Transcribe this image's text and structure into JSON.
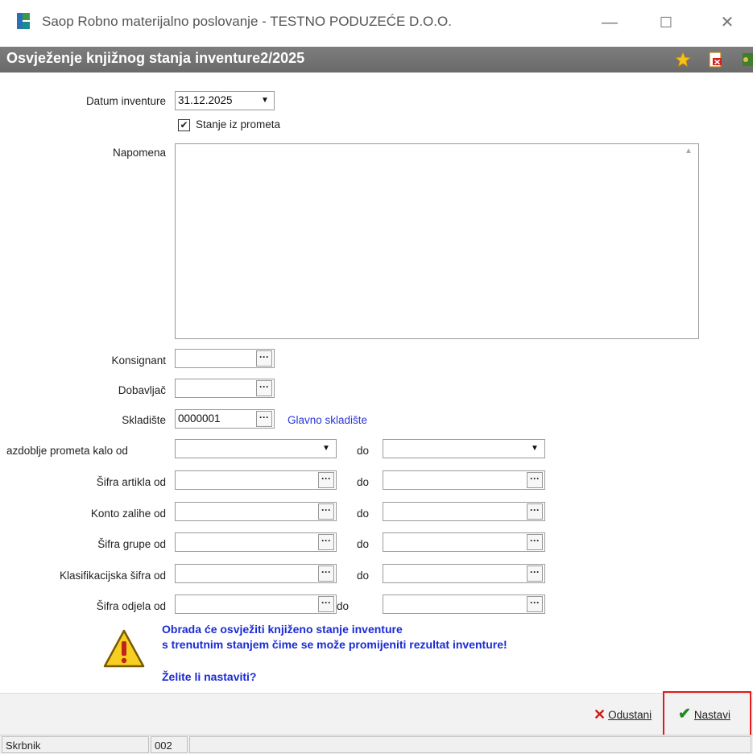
{
  "window": {
    "title": "Saop Robno materijalno poslovanje - TESTNO PODUZEĆE D.O.O.",
    "minimize": "—",
    "maximize": "☐",
    "close": "✕"
  },
  "header": {
    "title": "Osvježenje knjižnog stanja inventure2/2025"
  },
  "form": {
    "datum_label": "Datum inventure",
    "datum_value": "31.12.2025",
    "stanje_checkbox_label": "Stanje iz prometa",
    "stanje_checked": true,
    "napomena_label": "Napomena",
    "napomena_value": "",
    "konsignant_label": "Konsignant",
    "dobavljac_label": "Dobavljač",
    "skladiste_label": "Skladište",
    "skladiste_value": "0000001",
    "skladiste_name": "Glavno skladište",
    "range_rows": [
      {
        "label": "azdoblje prometa kalo od",
        "to": "do",
        "kind": "dropdown"
      },
      {
        "label": "Šifra artikla od",
        "to": "do",
        "kind": "lookup"
      },
      {
        "label": "Konto zalihe od",
        "to": "do",
        "kind": "lookup"
      },
      {
        "label": "Šifra grupe od",
        "to": "do",
        "kind": "lookup"
      },
      {
        "label": "Klasifikacijska šifra od",
        "to": "do",
        "kind": "lookup"
      },
      {
        "label": "Šifra odjela od",
        "to": "do",
        "kind": "lookup"
      }
    ],
    "dots_glyph": "···"
  },
  "warning": {
    "line1": "Obrada će osvježiti knjiženo stanje inventure",
    "line2": "s trenutnim stanjem čime se može promijeniti rezultat inventure!",
    "question": "Želite li nastaviti?"
  },
  "buttons": {
    "cancel": "Odustani",
    "continue": "Nastavi"
  },
  "statusbar": {
    "user": "Skrbnik",
    "code": "002"
  },
  "colors": {
    "header_bg": "#747474",
    "link": "#2b36d9",
    "warning_text": "#1a2ad3",
    "highlight": "#e31b1b"
  }
}
